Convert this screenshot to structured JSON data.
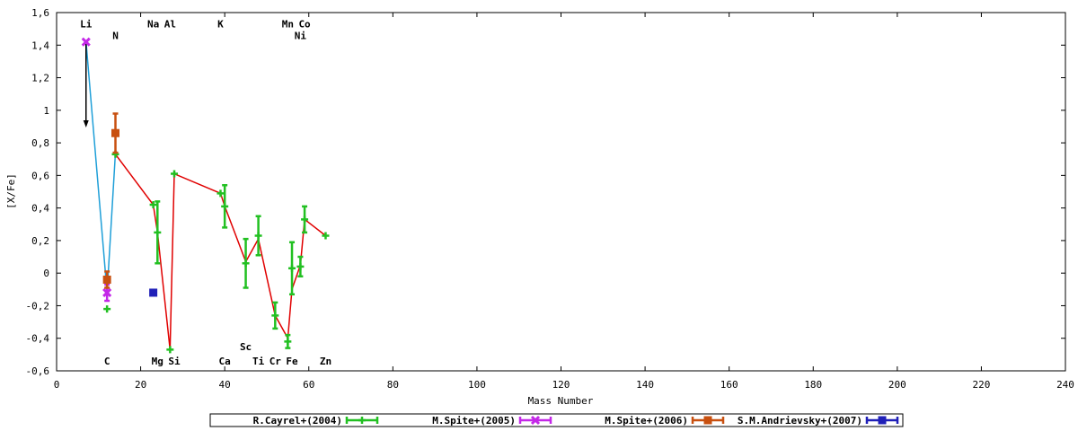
{
  "chart_data": {
    "type": "scatter",
    "xlabel": "Mass Number",
    "ylabel": "[X/Fe]",
    "xlim": [
      0,
      240
    ],
    "ylim": [
      -0.6,
      1.6
    ],
    "xticks": [
      0,
      20,
      40,
      60,
      80,
      100,
      120,
      140,
      160,
      180,
      200,
      220,
      240
    ],
    "xtick_labels": [
      "0",
      "20",
      "40",
      "60",
      "80",
      "100",
      "120",
      "140",
      "160",
      "180",
      "200",
      "220",
      "240"
    ],
    "yticks": [
      -0.6,
      -0.4,
      -0.2,
      0,
      0.2,
      0.4,
      0.6,
      0.8,
      1,
      1.2,
      1.4,
      1.6
    ],
    "ytick_labels": [
      "-0,6",
      "-0,4",
      "-0,2",
      "0",
      "0,2",
      "0,4",
      "0,6",
      "0,8",
      "1",
      "1,2",
      "1,4",
      "1,6"
    ],
    "grid": false,
    "legend_placement": "bottom",
    "element_labels_top": [
      {
        "text": "Li",
        "x": 7,
        "y": 1.53
      },
      {
        "text": "N",
        "x": 14,
        "y": 1.46
      },
      {
        "text": "Na",
        "x": 23,
        "y": 1.53
      },
      {
        "text": "Al",
        "x": 27,
        "y": 1.53
      },
      {
        "text": "K",
        "x": 39,
        "y": 1.53
      },
      {
        "text": "Mn",
        "x": 55,
        "y": 1.53
      },
      {
        "text": "Co",
        "x": 59,
        "y": 1.53
      },
      {
        "text": "Ni",
        "x": 58,
        "y": 1.46
      }
    ],
    "element_labels_bottom": [
      {
        "text": "Sc",
        "x": 45,
        "y": -0.45
      },
      {
        "text": "C",
        "x": 12,
        "y": -0.54
      },
      {
        "text": "Mg",
        "x": 24,
        "y": -0.54
      },
      {
        "text": "Si",
        "x": 28,
        "y": -0.54
      },
      {
        "text": "Ca",
        "x": 40,
        "y": -0.54
      },
      {
        "text": "Ti",
        "x": 48,
        "y": -0.54
      },
      {
        "text": "Cr",
        "x": 52,
        "y": -0.54
      },
      {
        "text": "Fe",
        "x": 56,
        "y": -0.54
      },
      {
        "text": "Zn",
        "x": 64,
        "y": -0.54
      }
    ],
    "connecting_lines": [
      {
        "color": "#1f9fd8",
        "points": [
          [
            7,
            1.42
          ],
          [
            12,
            -0.12
          ],
          [
            14,
            0.74
          ]
        ]
      },
      {
        "color": "#e00000",
        "points": [
          [
            14,
            0.73
          ],
          [
            23,
            0.42
          ],
          [
            24,
            0.25
          ],
          [
            27,
            -0.47
          ],
          [
            28,
            0.61
          ],
          [
            39,
            0.49
          ],
          [
            40,
            0.41
          ],
          [
            45,
            0.07
          ],
          [
            48,
            0.21
          ],
          [
            52,
            -0.26
          ],
          [
            55,
            -0.4
          ],
          [
            56,
            -0.1
          ],
          [
            58,
            0.05
          ],
          [
            59,
            0.33
          ],
          [
            64,
            0.23
          ]
        ]
      }
    ],
    "upper_limit_arrow": {
      "x": 7,
      "from": 1.42,
      "to": 0.9,
      "color": "#000000"
    },
    "series": [
      {
        "name": "R.Cayrel+(2004)",
        "color": "#22c022",
        "marker": "plus",
        "points": [
          {
            "x": 12,
            "y": -0.22,
            "err": 0
          },
          {
            "x": 14,
            "y": 0.73,
            "err": 0
          },
          {
            "x": 23,
            "y": 0.42,
            "err": 0
          },
          {
            "x": 24,
            "y": 0.25,
            "err": 0.19
          },
          {
            "x": 27,
            "y": -0.47,
            "err": 0
          },
          {
            "x": 28,
            "y": 0.61,
            "err": 0
          },
          {
            "x": 39,
            "y": 0.49,
            "err": 0
          },
          {
            "x": 40,
            "y": 0.41,
            "err": 0.13
          },
          {
            "x": 45,
            "y": 0.06,
            "err": 0.15
          },
          {
            "x": 48,
            "y": 0.23,
            "err": 0.12
          },
          {
            "x": 52,
            "y": -0.26,
            "err": 0.08
          },
          {
            "x": 55,
            "y": -0.42,
            "err": 0.04
          },
          {
            "x": 56,
            "y": 0.03,
            "err": 0.16
          },
          {
            "x": 58,
            "y": 0.04,
            "err": 0.06
          },
          {
            "x": 59,
            "y": 0.33,
            "err": 0.08
          },
          {
            "x": 64,
            "y": 0.23,
            "err": 0
          }
        ]
      },
      {
        "name": "M.Spite+(2005)",
        "color": "#c428e8",
        "marker": "cross",
        "points": [
          {
            "x": 7,
            "y": 1.42,
            "err": 0
          },
          {
            "x": 12,
            "y": -0.12,
            "err": 0.05
          }
        ]
      },
      {
        "name": "M.Spite+(2006)",
        "color": "#c85010",
        "marker": "square",
        "points": [
          {
            "x": 12,
            "y": -0.04,
            "err": 0.05
          },
          {
            "x": 14,
            "y": 0.86,
            "err": 0.12
          }
        ]
      },
      {
        "name": "S.M.Andrievsky+(2007)",
        "color": "#2020b8",
        "marker": "square",
        "points": [
          {
            "x": 23,
            "y": -0.12,
            "err": 0
          }
        ]
      }
    ]
  }
}
